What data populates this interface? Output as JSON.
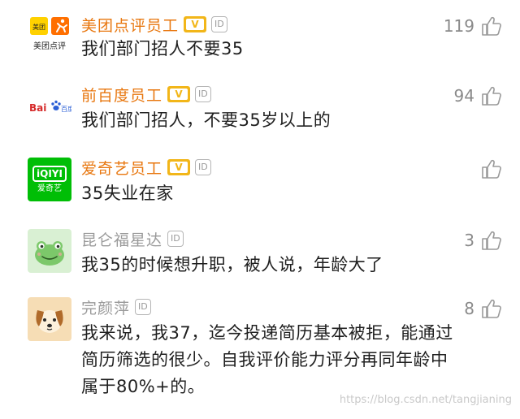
{
  "comments": [
    {
      "name": "美团点评员工",
      "v_badge": "V",
      "id_badge": "ID",
      "text": "我们部门招人不要35",
      "likes": "119",
      "avatar": {
        "line1": "美团",
        "line2": "美团点评",
        "icon": "running-figure-icon"
      }
    },
    {
      "name": "前百度员工",
      "v_badge": "V",
      "id_badge": "ID",
      "text": "我们部门招人，不要35岁以上的",
      "likes": "94",
      "avatar": {
        "brand": "Bai",
        "brand_cn": "百度",
        "icon": "paw-icon"
      }
    },
    {
      "name": "爱奇艺员工",
      "v_badge": "V",
      "id_badge": "ID",
      "text": "35失业在家",
      "likes": "",
      "avatar": {
        "logo": "iQIYI",
        "sub": "爱奇艺"
      }
    },
    {
      "name": "昆仑福星达",
      "id_badge": "ID",
      "text": "我35的时候想升职，被人说，年龄大了",
      "likes": "3",
      "avatar": {
        "icon": "frog-icon"
      }
    },
    {
      "name": "完颜萍",
      "id_badge": "ID",
      "text": "我来说，我37，迄今投递简历基本被拒，能通过简历筛选的很少。自我评价能力评分再同年龄中属于80%+的。",
      "likes": "8",
      "avatar": {
        "icon": "dog-icon"
      }
    }
  ],
  "watermark": "https://blog.csdn.net/tangjianing",
  "colors": {
    "name_verified": "#e8770f",
    "name_plain": "#9a9a9a",
    "v_badge": "#f2b619",
    "meituan_yellow": "#ffd100",
    "meituan_orange": "#ff6f00",
    "iqiyi_green": "#00be06",
    "frog_bg": "#d9f0d3",
    "dog_bg": "#f6ddb5"
  }
}
